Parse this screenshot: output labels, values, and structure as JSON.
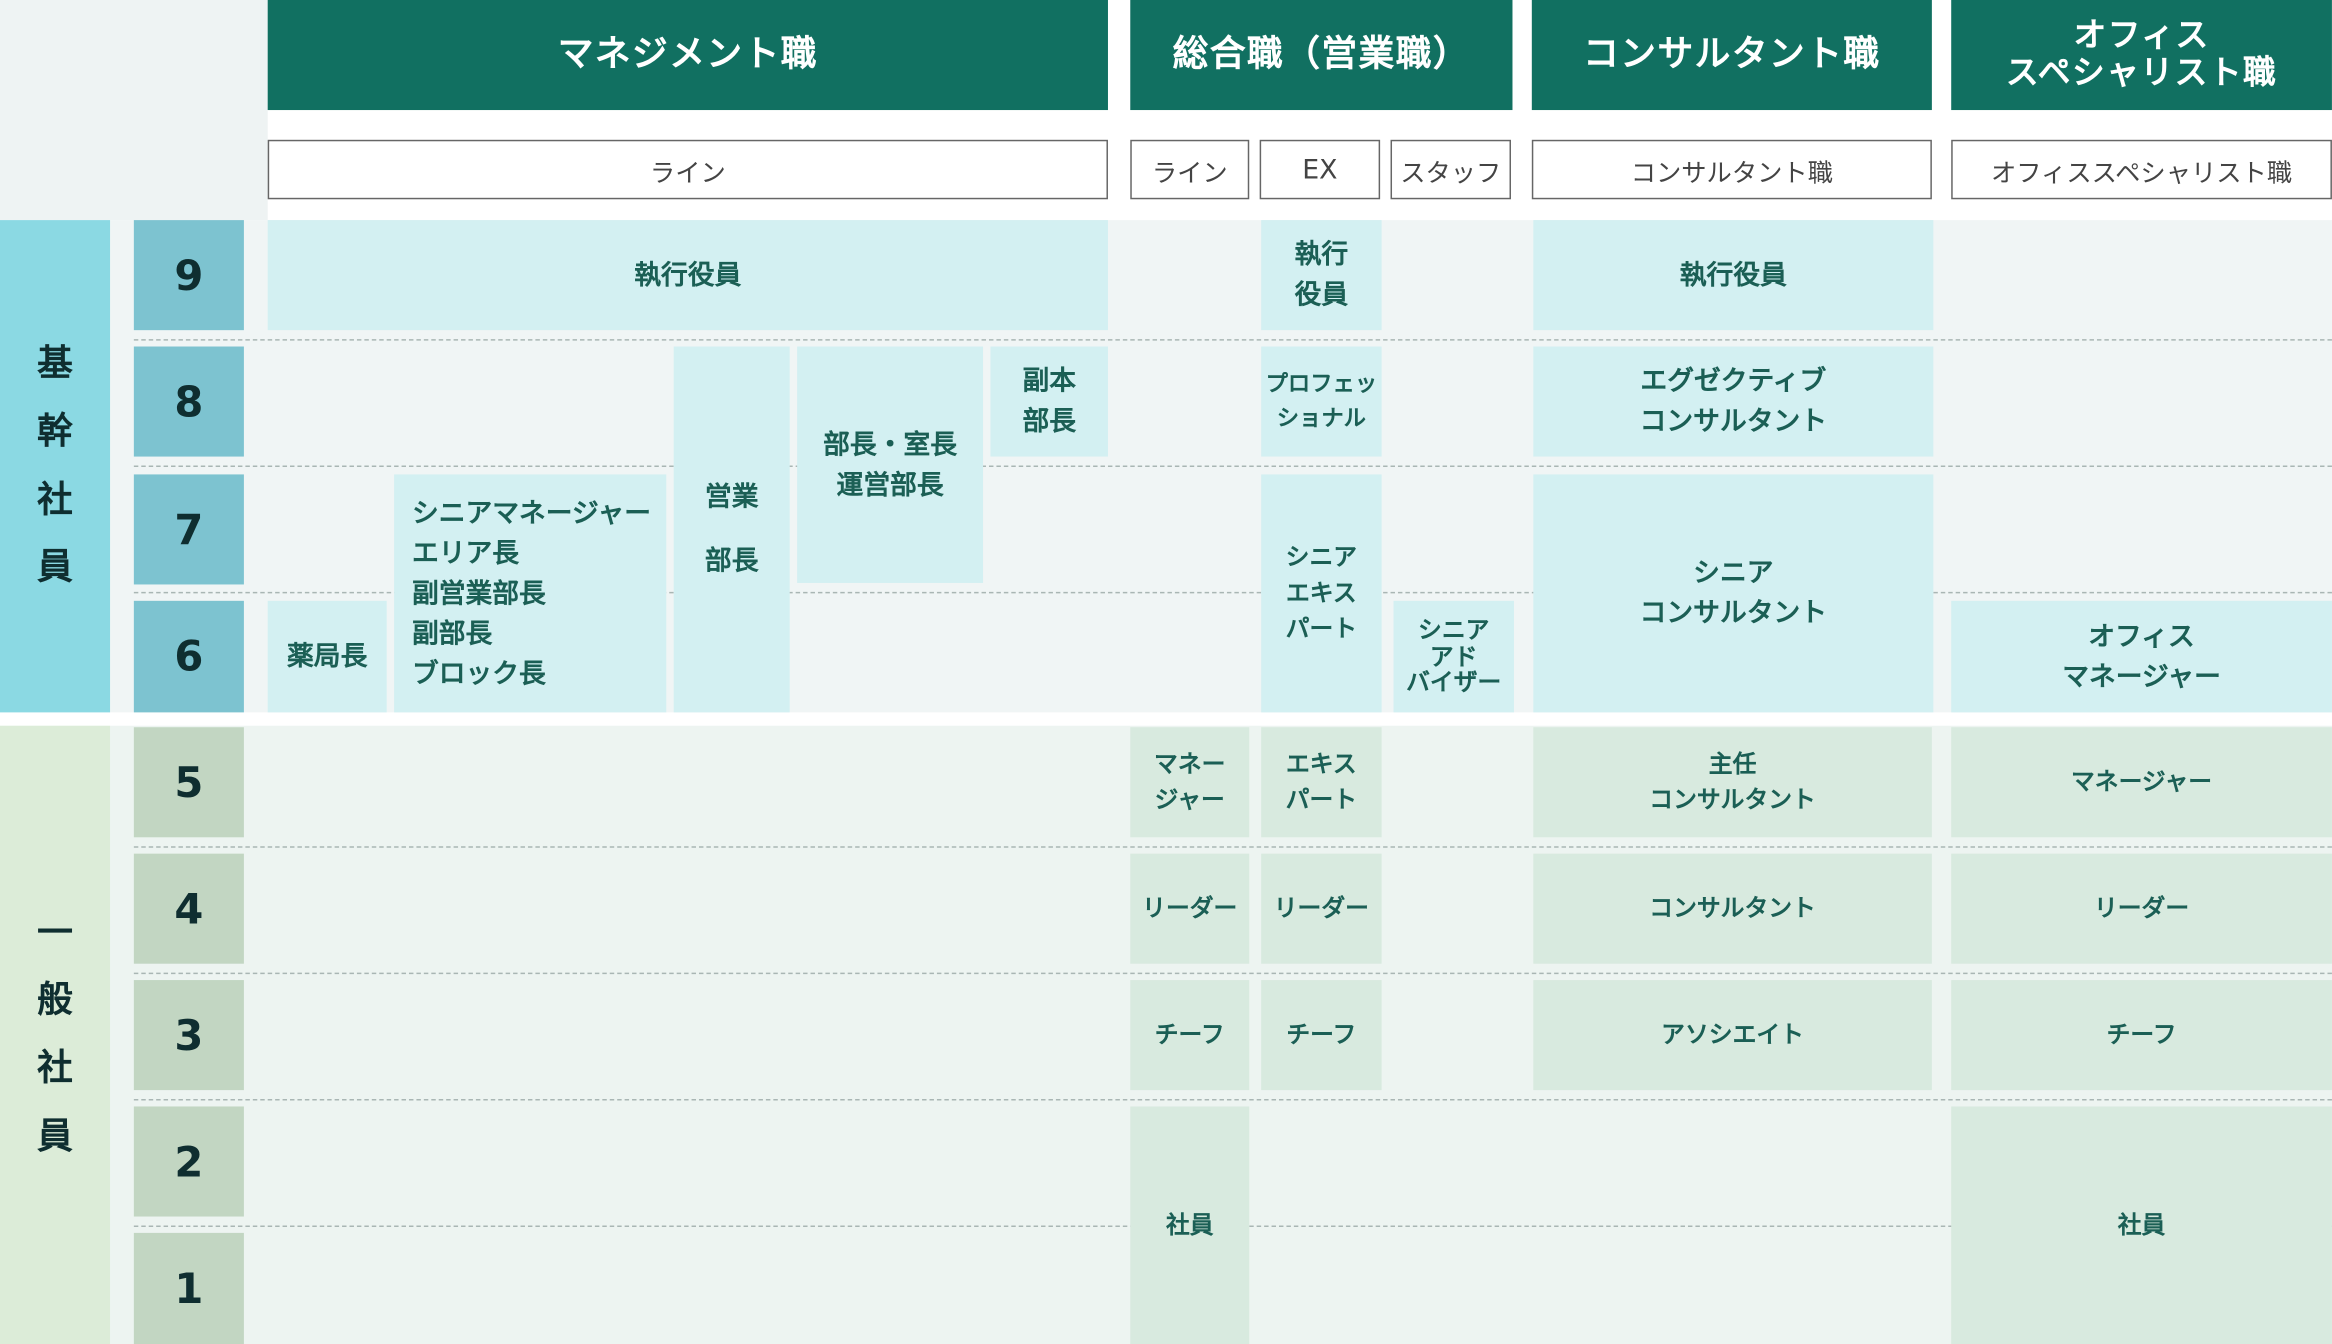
{
  "headers": {
    "management": "マネジメント職",
    "general": "総合職（営業職）",
    "consultant": "コンサルタント職",
    "office": "オフィス\nスペシャリスト職"
  },
  "subheaders": {
    "mgmt_line": "ライン",
    "gen_line": "ライン",
    "gen_ex": "EX",
    "gen_staff": "スタッフ",
    "consultant": "コンサルタント職",
    "office": "オフィススペシャリスト職"
  },
  "categories": {
    "upper": "基\n幹\n社\n員",
    "lower": "一\n般\n社\n員"
  },
  "grades": [
    "9",
    "8",
    "7",
    "6",
    "5",
    "4",
    "3",
    "2",
    "1"
  ],
  "cells": {
    "mgmt_exec": "執行役員",
    "yakkyokucho": "薬局長",
    "senior_mgr": "シニアマネージャー\nエリア長\n副営業部長\n副部長\nブロック長",
    "eigyo_bucho": "営業\n\n部長",
    "bucho": "部長・室長\n運営部長",
    "fuku_hombucho": "副本\n部長",
    "gen_line_manager": "マネー\nジャー",
    "gen_line_leader": "リーダー",
    "gen_line_chief": "チーフ",
    "gen_line_staff": "社員",
    "ex_exec": "執行\n役員",
    "ex_professional": "プロフェッ\nショナル",
    "ex_senior_expert": "シニア\nエキス\nパート",
    "ex_expert": "エキス\nパート",
    "ex_leader": "リーダー",
    "ex_chief": "チーフ",
    "staff_senior_adviser": "シニア\nアド\nバイザー",
    "con_exec": "執行役員",
    "con_executive": "エグゼクティブ\nコンサルタント",
    "con_senior": "シニア\nコンサルタント",
    "con_chief": "主任\nコンサルタント",
    "con_consultant": "コンサルタント",
    "con_associate": "アソシエイト",
    "off_manager": "オフィス\nマネージャー",
    "off_mgr": "マネージャー",
    "off_leader": "リーダー",
    "off_chief": "チーフ",
    "off_staff": "社員"
  },
  "colors": {
    "header": "#117061",
    "upper_cell": "#d3f0f2",
    "lower_cell": "#d8eadf",
    "upper_category": "#8bd9e3",
    "lower_category": "#dcecd8",
    "upper_grade": "#7dc3d0",
    "lower_grade": "#c2d6c2"
  }
}
